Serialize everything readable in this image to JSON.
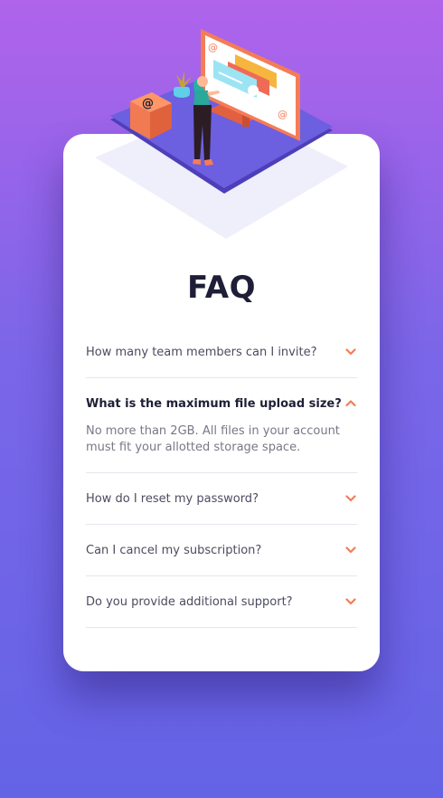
{
  "faq": {
    "title": "FAQ",
    "items": [
      {
        "question": "How many team members can I invite?",
        "open": false
      },
      {
        "question": "What is the maximum file upload size?",
        "open": true,
        "answer": "No more than 2GB. All files in your account must fit your allotted storage space."
      },
      {
        "question": "How do I reset my password?",
        "open": false
      },
      {
        "question": "Can I cancel my subscription?",
        "open": false
      },
      {
        "question": "Do you provide additional support?",
        "open": false
      }
    ]
  },
  "colors": {
    "accent": "#f47c57",
    "title": "#1e1f36",
    "question": "#4b4c5f",
    "answer": "#787887",
    "divider": "#e6e6ee",
    "background_top": "#b063eb",
    "background_bottom": "#6463e6"
  },
  "icons": {
    "collapsed": "chevron-down-icon",
    "expanded": "chevron-up-icon"
  }
}
